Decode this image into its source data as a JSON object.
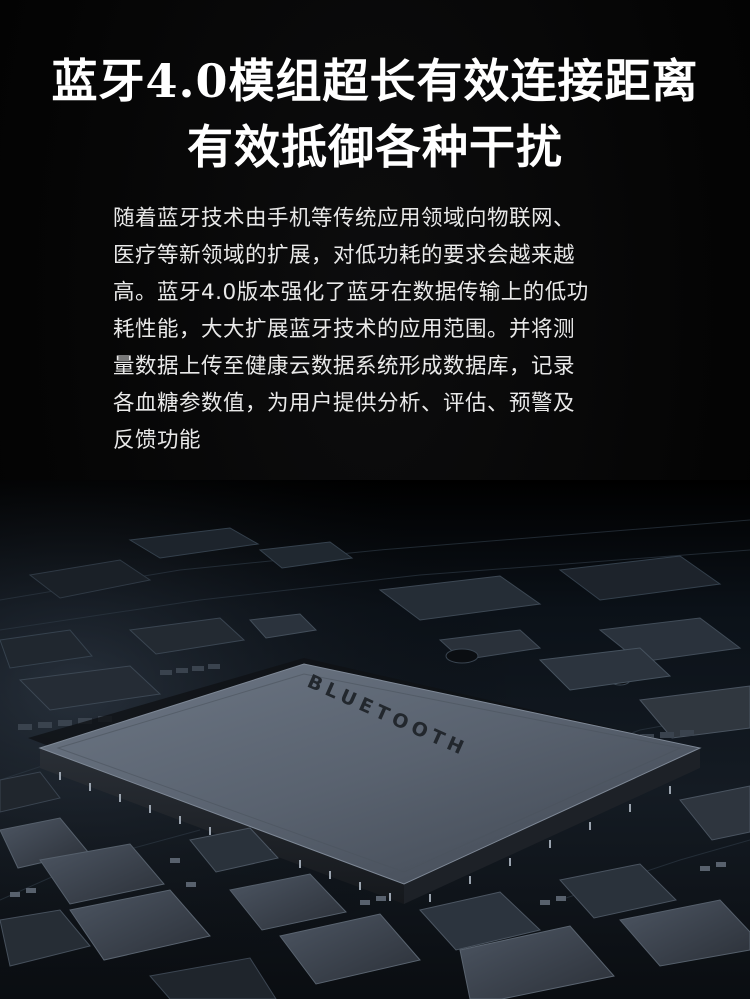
{
  "headline": {
    "line1": "蓝牙4.0模组超长有效连接距离",
    "line2": "有效抵御各种干扰"
  },
  "description": {
    "lines": [
      "随着蓝牙技术由手机等传统应用领域向物联网、",
      "医疗等新领域的扩展，对低功耗的要求会越来越",
      "高。蓝牙4.0版本强化了蓝牙在数据传输上的低功",
      "耗性能，大大扩展蓝牙技术的应用范围。并将测",
      "量数据上传至健康云数据系统形成数据库，记录",
      "各血糖参数值，为用户提供分析、评估、预警及",
      "反馈功能"
    ]
  },
  "chip": {
    "label": "BLUETOOTH"
  },
  "colors": {
    "background": "#000000",
    "text": "#ffffff",
    "chip_top": "#5a6472",
    "board": "#0c1218"
  }
}
